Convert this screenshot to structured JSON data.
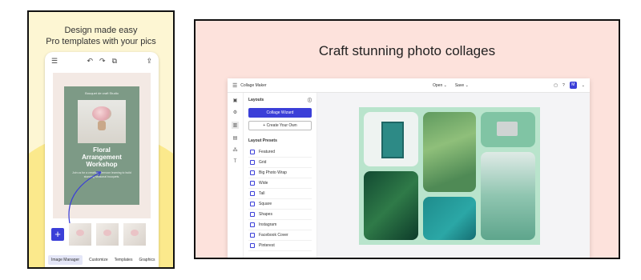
{
  "promo": {
    "title_line1": "Design made easy",
    "title_line2": "Pro templates with your pics",
    "poster": {
      "small_text": "Bouquet de craft Studio",
      "heading_line1": "Floral",
      "heading_line2": "Arrangement",
      "heading_line3": "Workshop",
      "desc": "Join us for a creative afternoon learning to build stunning seasonal bouquets."
    },
    "add_symbol": "+",
    "tabs": [
      "Image Manager",
      "Customize",
      "Templates",
      "Graphics"
    ]
  },
  "main": {
    "title": "Craft stunning photo collages",
    "app": {
      "name": "Collage Maker",
      "open_label": "Open ⌄",
      "save_label": "Save ⌄",
      "avatar_initial": "M",
      "panel_title": "Layouts",
      "wizard_label": "Collage Wizard",
      "create_label": "+ Create Your Own",
      "presets_title": "Layout Presets",
      "presets": [
        "Featured",
        "Grid",
        "Big Photo Wrap",
        "Wide",
        "Tall",
        "Square",
        "Shapes",
        "Instagram",
        "Facebook Cover",
        "Pinterest"
      ]
    }
  },
  "colors": {
    "accent": "#3b3fd8",
    "promo_bg": "#fdf6d3",
    "main_bg": "#fde2dc",
    "collage_bg": "#b9e4cc"
  }
}
